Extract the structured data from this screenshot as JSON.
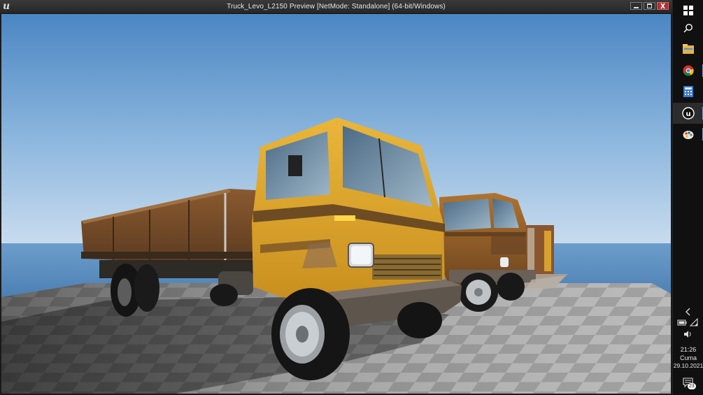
{
  "window": {
    "title": "Truck_Levo_L2150 Preview [NetMode: Standalone]  (64-bit/Windows)",
    "logo": "u"
  },
  "controls": [
    "minimize-icon",
    "maximize-icon",
    "close-icon"
  ],
  "taskbar": {
    "icons": [
      "windows-start-icon",
      "search-icon",
      "file-explorer-icon",
      "chrome-icon",
      "calculator-icon",
      "unreal-engine-icon",
      "paint-icon"
    ],
    "active": "unreal-engine-icon",
    "tray": [
      "chevron-left-icon",
      "battery-icon",
      "wifi-icon",
      "volume-icon"
    ],
    "time": "21:26",
    "day": "Cuma",
    "date": "29.10.2021",
    "notifications": "23"
  },
  "colors": {
    "sky_top": "#4f87c2",
    "sky_horizon": "#c7dbee",
    "sea": "#5b8fc0",
    "truck_yellow": "#e0a52a",
    "rust": "#7a4a22"
  }
}
